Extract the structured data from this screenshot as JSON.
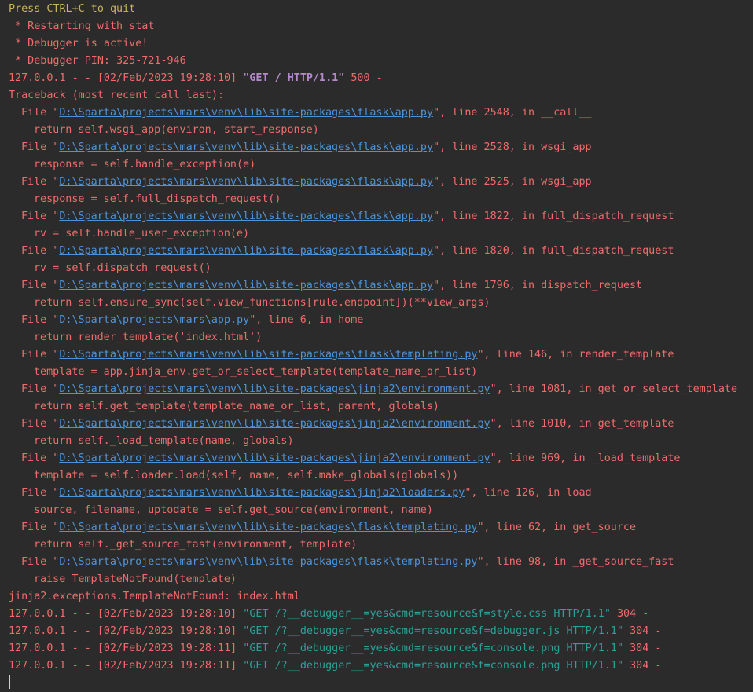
{
  "header": {
    "quit_hint": "Press CTRL+C to quit",
    "restart": " * Restarting with stat",
    "debugger_active": " * Debugger is active!",
    "debugger_pin": " * Debugger PIN: 325-721-946"
  },
  "request_500": {
    "prefix": "127.0.0.1 - - [02/Feb/2023 19:28:10] ",
    "request": "\"GET / HTTP/1.1\"",
    "status": " 500 -"
  },
  "traceback": {
    "header": "Traceback (most recent call last):",
    "frames": [
      {
        "pre": "File \"",
        "path": "D:\\Sparta\\projects\\mars\\venv\\lib\\site-packages\\flask\\app.py",
        "post": "\", line 2548, in __call__",
        "code": "return self.wsgi_app(environ, start_response)"
      },
      {
        "pre": "File \"",
        "path": "D:\\Sparta\\projects\\mars\\venv\\lib\\site-packages\\flask\\app.py",
        "post": "\", line 2528, in wsgi_app",
        "code": "response = self.handle_exception(e)"
      },
      {
        "pre": "File \"",
        "path": "D:\\Sparta\\projects\\mars\\venv\\lib\\site-packages\\flask\\app.py",
        "post": "\", line 2525, in wsgi_app",
        "code": "response = self.full_dispatch_request()"
      },
      {
        "pre": "File \"",
        "path": "D:\\Sparta\\projects\\mars\\venv\\lib\\site-packages\\flask\\app.py",
        "post": "\", line 1822, in full_dispatch_request",
        "code": "rv = self.handle_user_exception(e)"
      },
      {
        "pre": "File \"",
        "path": "D:\\Sparta\\projects\\mars\\venv\\lib\\site-packages\\flask\\app.py",
        "post": "\", line 1820, in full_dispatch_request",
        "code": "rv = self.dispatch_request()"
      },
      {
        "pre": "File \"",
        "path": "D:\\Sparta\\projects\\mars\\venv\\lib\\site-packages\\flask\\app.py",
        "post": "\", line 1796, in dispatch_request",
        "code": "return self.ensure_sync(self.view_functions[rule.endpoint])(**view_args)"
      },
      {
        "pre": "File \"",
        "path": "D:\\Sparta\\projects\\mars\\app.py",
        "post": "\", line 6, in home",
        "code": "return render_template('index.html')"
      },
      {
        "pre": "File \"",
        "path": "D:\\Sparta\\projects\\mars\\venv\\lib\\site-packages\\flask\\templating.py",
        "post": "\", line 146, in render_template",
        "code": "template = app.jinja_env.get_or_select_template(template_name_or_list)"
      },
      {
        "pre": "File \"",
        "path": "D:\\Sparta\\projects\\mars\\venv\\lib\\site-packages\\jinja2\\environment.py",
        "post": "\", line 1081, in get_or_select_template",
        "code": "return self.get_template(template_name_or_list, parent, globals)"
      },
      {
        "pre": "File \"",
        "path": "D:\\Sparta\\projects\\mars\\venv\\lib\\site-packages\\jinja2\\environment.py",
        "post": "\", line 1010, in get_template",
        "code": "return self._load_template(name, globals)"
      },
      {
        "pre": "File \"",
        "path": "D:\\Sparta\\projects\\mars\\venv\\lib\\site-packages\\jinja2\\environment.py",
        "post": "\", line 969, in _load_template",
        "code": "template = self.loader.load(self, name, self.make_globals(globals))"
      },
      {
        "pre": "File \"",
        "path": "D:\\Sparta\\projects\\mars\\venv\\lib\\site-packages\\jinja2\\loaders.py",
        "post": "\", line 126, in load",
        "code": "source, filename, uptodate = self.get_source(environment, name)"
      },
      {
        "pre": "File \"",
        "path": "D:\\Sparta\\projects\\mars\\venv\\lib\\site-packages\\flask\\templating.py",
        "post": "\", line 62, in get_source",
        "code": "return self._get_source_fast(environment, template)"
      },
      {
        "pre": "File \"",
        "path": "D:\\Sparta\\projects\\mars\\venv\\lib\\site-packages\\flask\\templating.py",
        "post": "\", line 98, in _get_source_fast",
        "code": "raise TemplateNotFound(template)"
      }
    ],
    "exception": "jinja2.exceptions.TemplateNotFound: index.html"
  },
  "resource_requests": [
    {
      "prefix": "127.0.0.1 - - [02/Feb/2023 19:28:10] ",
      "request": "\"GET /?__debugger__=yes&cmd=resource&f=style.css HTTP/1.1\"",
      "status": " 304 -"
    },
    {
      "prefix": "127.0.0.1 - - [02/Feb/2023 19:28:10] ",
      "request": "\"GET /?__debugger__=yes&cmd=resource&f=debugger.js HTTP/1.1\"",
      "status": " 304 -"
    },
    {
      "prefix": "127.0.0.1 - - [02/Feb/2023 19:28:11] ",
      "request": "\"GET /?__debugger__=yes&cmd=resource&f=console.png HTTP/1.1\"",
      "status": " 304 -"
    },
    {
      "prefix": "127.0.0.1 - - [02/Feb/2023 19:28:11] ",
      "request": "\"GET /?__debugger__=yes&cmd=resource&f=console.png HTTP/1.1\"",
      "status": " 304 -"
    }
  ],
  "colors": {
    "background": "#2b2b2b",
    "error_text": "#f06c6c",
    "warning_text": "#c9b55b",
    "link": "#4e93d9",
    "request_500": "#b58acc",
    "request_304": "#2aa198"
  }
}
